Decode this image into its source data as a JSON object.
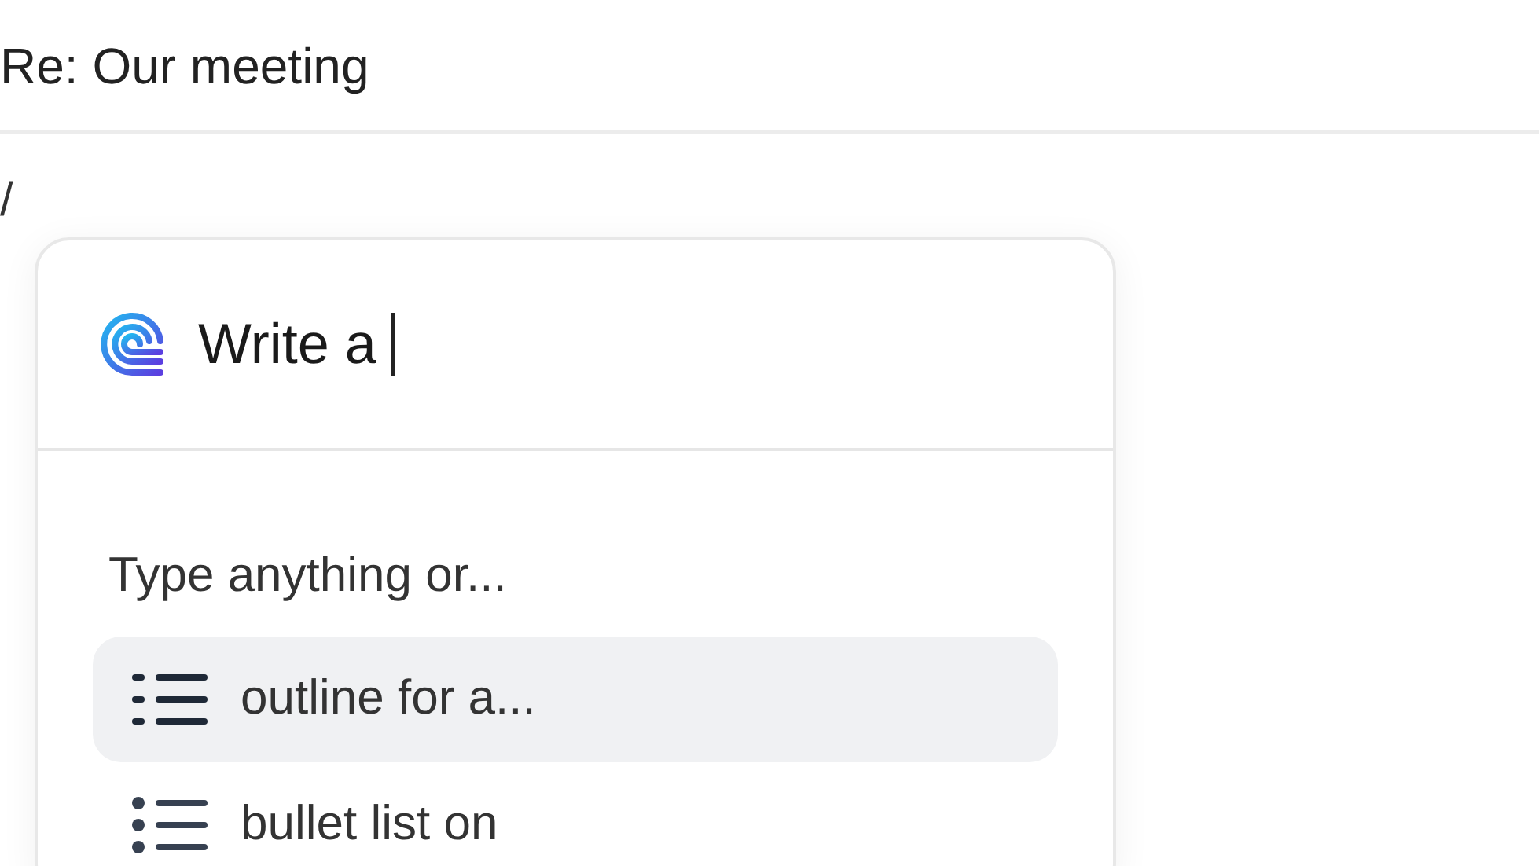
{
  "subject": "Re: Our meeting",
  "body_text": "/",
  "ai_prompt": {
    "value": "Write a "
  },
  "suggestions": {
    "heading": "Type anything or...",
    "items": [
      {
        "kind": "outline",
        "label": "outline for a...",
        "selected": true
      },
      {
        "kind": "bullet",
        "label": "bullet list on",
        "selected": false
      }
    ]
  }
}
